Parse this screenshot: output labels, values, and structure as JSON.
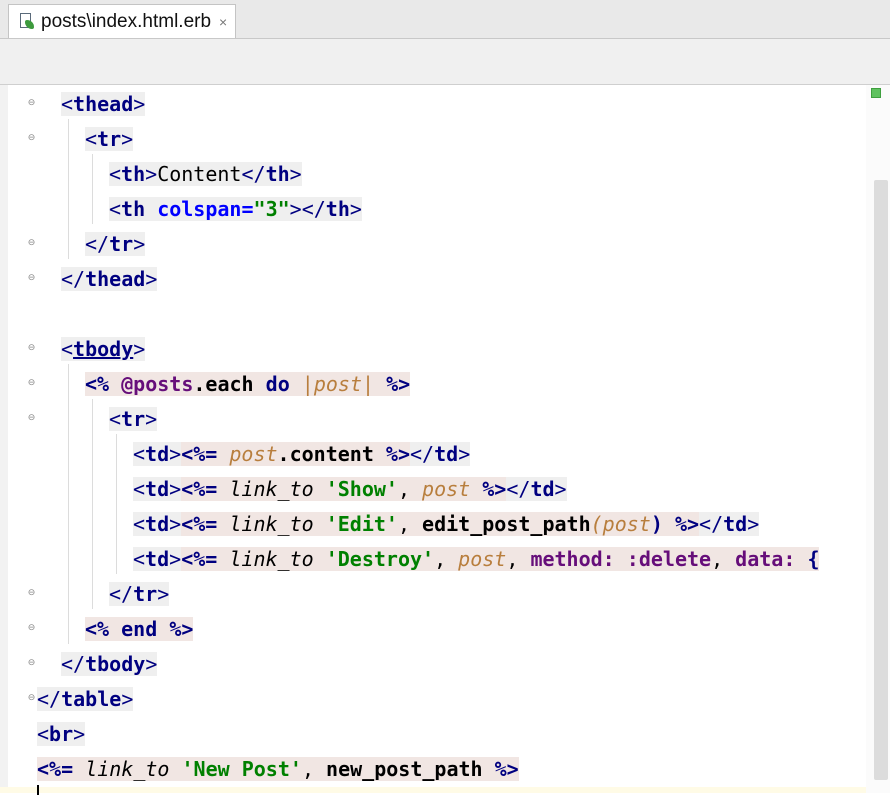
{
  "tab": {
    "title": "posts\\index.html.erb",
    "close": "×"
  },
  "code": {
    "thead_open": "thead",
    "tr": "tr",
    "th": "th",
    "content_header": "Content",
    "colspan_attr": "colspan",
    "colspan_value": "\"3\"",
    "tbody": "tbody",
    "erb_open": "<%",
    "erb_out": "<%=",
    "erb_close": "%>",
    "posts_ivar": "@posts",
    "each": ".each",
    "do": "do",
    "block_var": "post",
    "td": "td",
    "content_call": ".content",
    "link_to": "link_to",
    "show": "'Show'",
    "edit": "'Edit'",
    "destroy": "'Destroy'",
    "edit_path": "edit_post_path",
    "method_key": "method:",
    "delete_sym": ":delete",
    "data_key": "data:",
    "brace": "{",
    "end": "end",
    "table": "table",
    "br": "br",
    "new_post": "'New Post'",
    "new_post_path": "new_post_path"
  }
}
